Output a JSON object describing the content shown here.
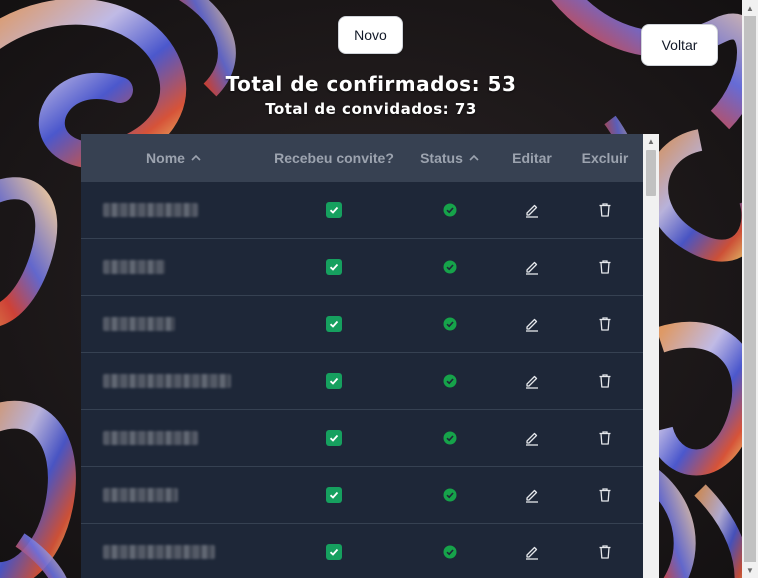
{
  "header": {
    "novo_label": "Novo",
    "voltar_label": "Voltar",
    "total_confirmados": "Total de confirmados: 53",
    "total_convidados": "Total de convidados: 73"
  },
  "table": {
    "columns": [
      {
        "label": "Nome",
        "sortable": true,
        "sort_icon": "chevron-up-icon"
      },
      {
        "label": "Recebeu convite?",
        "sortable": false
      },
      {
        "label": "Status",
        "sortable": true,
        "sort_icon": "chevron-up-icon"
      },
      {
        "label": "Editar",
        "sortable": false
      },
      {
        "label": "Excluir",
        "sortable": false
      }
    ],
    "rows": [
      {
        "name": "",
        "received_invite": true,
        "status": "confirmed",
        "edit_icon": "pencil-icon",
        "delete_icon": "trash-icon"
      },
      {
        "name": "",
        "received_invite": true,
        "status": "confirmed",
        "edit_icon": "pencil-icon",
        "delete_icon": "trash-icon"
      },
      {
        "name": "",
        "received_invite": true,
        "status": "confirmed",
        "edit_icon": "pencil-icon",
        "delete_icon": "trash-icon"
      },
      {
        "name": "",
        "received_invite": true,
        "status": "confirmed",
        "edit_icon": "pencil-icon",
        "delete_icon": "trash-icon"
      },
      {
        "name": "",
        "received_invite": true,
        "status": "confirmed",
        "edit_icon": "pencil-icon",
        "delete_icon": "trash-icon"
      },
      {
        "name": "",
        "received_invite": true,
        "status": "confirmed",
        "edit_icon": "pencil-icon",
        "delete_icon": "trash-icon"
      },
      {
        "name": "",
        "received_invite": true,
        "status": "confirmed",
        "edit_icon": "pencil-icon",
        "delete_icon": "trash-icon"
      }
    ]
  },
  "colors": {
    "table_header_bg": "#374152",
    "table_body_bg": "#1e2738",
    "checkbox_green": "#16a05f",
    "status_green": "#16a34a"
  }
}
